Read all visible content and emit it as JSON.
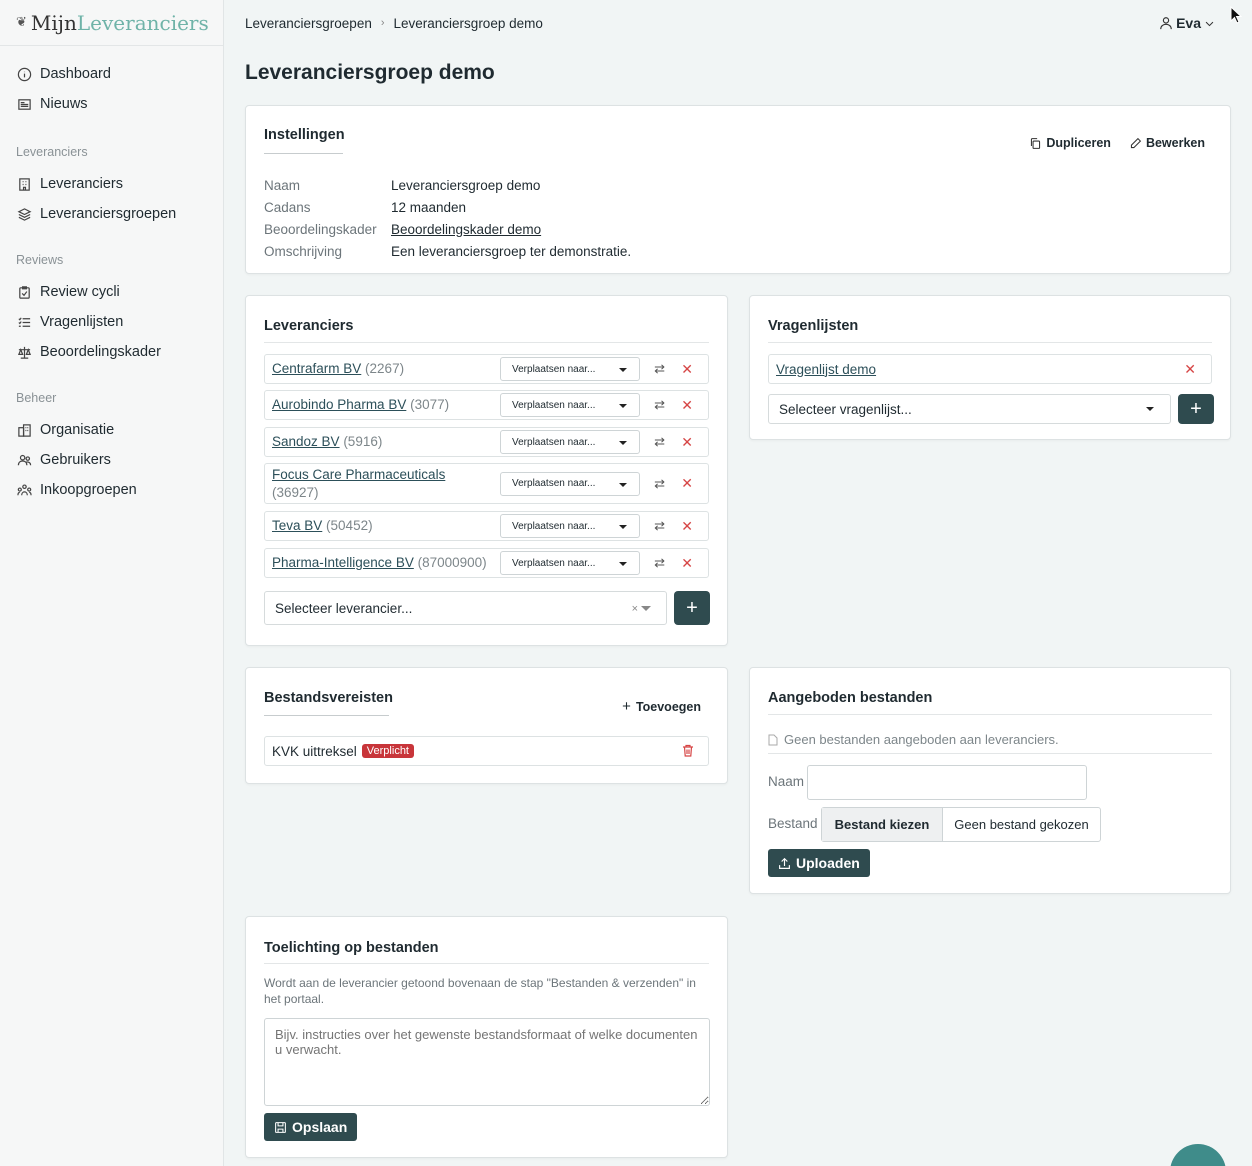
{
  "app": {
    "logo_part1": "Mijn",
    "logo_part2": "Leveranciers"
  },
  "sidebar": {
    "top": [
      {
        "label": "Dashboard",
        "icon": "info-circle-icon"
      },
      {
        "label": "Nieuws",
        "icon": "newspaper-icon"
      }
    ],
    "sections": [
      {
        "title": "Leveranciers",
        "items": [
          {
            "label": "Leveranciers",
            "icon": "building-icon"
          },
          {
            "label": "Leveranciersgroepen",
            "icon": "layers-icon"
          }
        ]
      },
      {
        "title": "Reviews",
        "items": [
          {
            "label": "Review cycli",
            "icon": "clipboard-icon"
          },
          {
            "label": "Vragenlijsten",
            "icon": "list-check-icon"
          },
          {
            "label": "Beoordelingskader",
            "icon": "scale-icon"
          }
        ]
      },
      {
        "title": "Beheer",
        "items": [
          {
            "label": "Organisatie",
            "icon": "office-icon"
          },
          {
            "label": "Gebruikers",
            "icon": "users-icon"
          },
          {
            "label": "Inkoopgroepen",
            "icon": "group-icon"
          }
        ]
      }
    ]
  },
  "breadcrumb": {
    "parent": "Leveranciersgroepen",
    "current": "Leveranciersgroep demo"
  },
  "user": {
    "name": "Eva"
  },
  "page": {
    "title": "Leveranciersgroep demo"
  },
  "settings": {
    "title": "Instellingen",
    "duplicate": "Dupliceren",
    "edit": "Bewerken",
    "fields": [
      {
        "key": "Naam",
        "value": "Leveranciersgroep demo"
      },
      {
        "key": "Cadans",
        "value": "12 maanden"
      },
      {
        "key": "Beoordelingskader",
        "value": "Beoordelingskader demo"
      },
      {
        "key": "Omschrijving",
        "value": "Een leveranciersgroep ter demonstratie."
      }
    ]
  },
  "suppliers": {
    "title": "Leveranciers",
    "move_label": "Verplaatsen naar...",
    "items": [
      {
        "name": "Centrafarm BV",
        "code": "(2267)"
      },
      {
        "name": "Aurobindo Pharma BV",
        "code": "(3077)"
      },
      {
        "name": "Sandoz BV",
        "code": "(5916)"
      },
      {
        "name": "Focus Care Pharmaceuticals",
        "code": "(36927)"
      },
      {
        "name": "Teva BV",
        "code": "(50452)"
      },
      {
        "name": "Pharma-Intelligence BV",
        "code": "(87000900)"
      }
    ],
    "select_placeholder": "Selecteer leverancier..."
  },
  "questionnaires": {
    "title": "Vragenlijsten",
    "items": [
      {
        "name": "Vragenlijst demo"
      }
    ],
    "select_placeholder": "Selecteer vragenlijst..."
  },
  "file_requirements": {
    "title": "Bestandsvereisten",
    "add": "Toevoegen",
    "items": [
      {
        "name": "KVK uittreksel",
        "badge": "Verplicht"
      }
    ]
  },
  "offered_files": {
    "title": "Aangeboden bestanden",
    "empty": "Geen bestanden aangeboden aan leveranciers.",
    "name_label": "Naam",
    "file_label": "Bestand",
    "choose": "Bestand kiezen",
    "none_chosen": "Geen bestand gekozen",
    "upload": "Uploaden"
  },
  "file_notes": {
    "title": "Toelichting op bestanden",
    "help": "Wordt aan de leverancier getoond bovenaan de stap \"Bestanden & verzenden\" in het portaal.",
    "placeholder": "Bijv. instructies over het gewenste bestandsformaat of welke documenten u verwacht.",
    "save": "Opslaan"
  },
  "colors": {
    "primary": "#2f4b4f",
    "link": "#2c4f59",
    "danger": "#d64545",
    "badge": "#c8353a",
    "logo_accent": "#6fb3a8"
  }
}
